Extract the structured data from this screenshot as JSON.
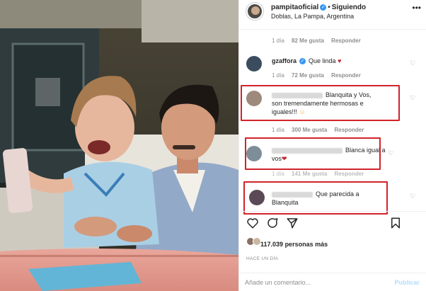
{
  "post": {
    "username": "pampitaoficial",
    "verified_icon": "verified-badge-icon",
    "dot": "•",
    "follow_status": "Siguiendo",
    "location": "Doblas, La Pampa, Argentina",
    "more_icon": "more-options-icon"
  },
  "comments": [
    {
      "meta": {
        "time": "1 día",
        "likes": "82 Me gusta",
        "reply": "Responder"
      }
    },
    {
      "username": "gzaffora",
      "verified": true,
      "text": "Que linda",
      "emoji": "♥",
      "meta": {
        "time": "1 día",
        "likes": "72 Me gusta",
        "reply": "Responder"
      }
    },
    {
      "username_hidden": true,
      "text_line1": "Blanquita y Vos,",
      "text_line2": "son tremendamente hermosas e",
      "text_line3": "iguales!!! ",
      "emoji": "☺",
      "meta": {
        "time": "1 día",
        "likes": "300 Me gusta",
        "reply": "Responder"
      }
    },
    {
      "username_hidden": true,
      "text_line1": "Blanca igual a",
      "text_line2": "vos",
      "emoji": "❤",
      "meta": {
        "time": "1 día",
        "likes": "141 Me gusta",
        "reply": "Responder"
      }
    },
    {
      "username_hidden": true,
      "text_line1": "Que parecida a",
      "text_line2": "Blanquita"
    }
  ],
  "heart_icon": "♡",
  "actions": {
    "like_icon": "heart-outline-icon",
    "comment_icon": "comment-bubble-icon",
    "share_icon": "paper-plane-icon",
    "save_icon": "bookmark-icon"
  },
  "likes": {
    "count": "117.039",
    "suffix": "personas más"
  },
  "timestamp": "HACE UN DÍA",
  "add_comment": {
    "placeholder": "Añade un comentario...",
    "publish_label": "Publicar"
  },
  "colors": {
    "highlight_box": "#d2232a",
    "verified": "#3897f0",
    "publish_disabled": "#b2dffc"
  }
}
